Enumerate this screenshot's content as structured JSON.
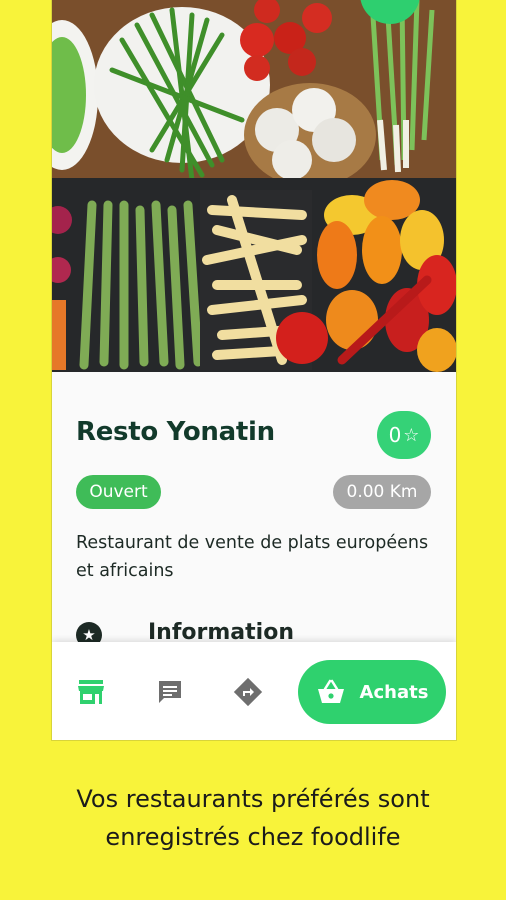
{
  "restaurant": {
    "name": "Resto Yonatin",
    "rating": "0",
    "status": "Ouvert",
    "distance": "0.00 Km",
    "description": "Restaurant de vente de plats européens et africains"
  },
  "section": {
    "info_label": "Information"
  },
  "bottom_nav": {
    "cart_label": "Achats"
  },
  "caption": {
    "line1": "Vos restaurants préférés sont",
    "line2": "enregistrés chez foodlife"
  },
  "colors": {
    "background": "#f8f33a",
    "accent_green": "#2fd16e",
    "open_green": "#3fbc58",
    "distance_gray": "#a6a6a6",
    "text_dark": "#123a2b"
  }
}
